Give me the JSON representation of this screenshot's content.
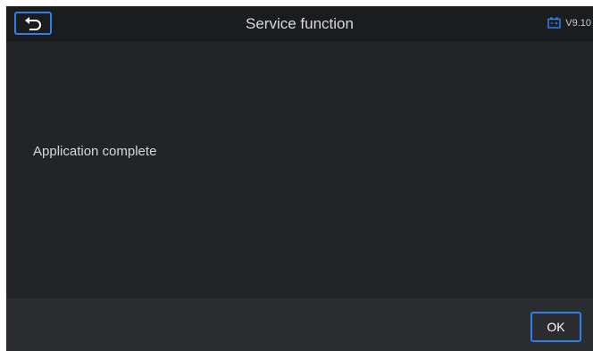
{
  "header": {
    "title": "Service function",
    "version": "V9.10",
    "back_icon": "back-arrow-icon",
    "status_icon": "battery-icon",
    "accent_color": "#2f80e8"
  },
  "main": {
    "message": "Application complete"
  },
  "footer": {
    "ok_label": "OK"
  }
}
